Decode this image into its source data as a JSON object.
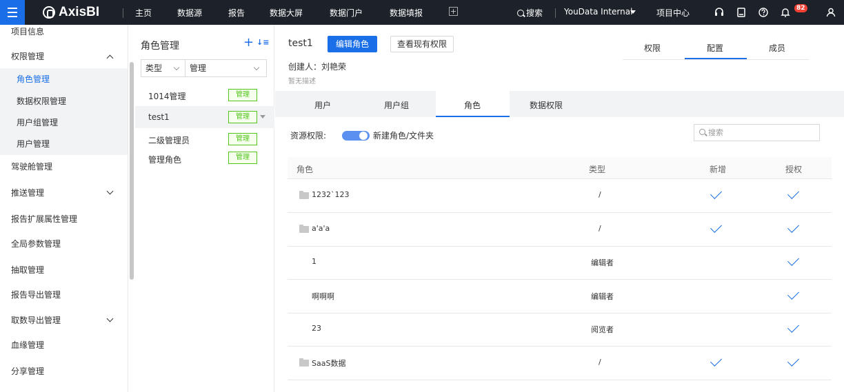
{
  "topbar": {
    "logo": "AxisBI",
    "nav": [
      "主页",
      "数据源",
      "报告",
      "数据大屏",
      "数据门户",
      "数据填报"
    ],
    "search_label": "搜索",
    "org": "YouData Internal",
    "project_center": "项目中心",
    "notification_count": "82"
  },
  "sidebar": {
    "items": [
      {
        "label": "项目信息"
      },
      {
        "label": "权限管理"
      },
      {
        "label": "角色管理"
      },
      {
        "label": "数据权限管理"
      },
      {
        "label": "用户组管理"
      },
      {
        "label": "用户管理"
      },
      {
        "label": "驾驶舱管理"
      },
      {
        "label": "推送管理"
      },
      {
        "label": "报告扩展属性管理"
      },
      {
        "label": "全局参数管理"
      },
      {
        "label": "抽取管理"
      },
      {
        "label": "报告导出管理"
      },
      {
        "label": "取数导出管理"
      },
      {
        "label": "血缘管理"
      },
      {
        "label": "分享管理"
      }
    ]
  },
  "role_panel": {
    "title": "角色管理",
    "add_icon": "plus-icon",
    "sort_icon": "sort-icon",
    "filter_type": "类型",
    "filter_value": "管理",
    "roles": [
      {
        "name": "1014管理",
        "tag": "管理"
      },
      {
        "name": "test1",
        "tag": "管理"
      },
      {
        "name": "二级管理员",
        "tag": "管理"
      },
      {
        "name": "管理角色",
        "tag": "管理"
      }
    ]
  },
  "main": {
    "role_name": "test1",
    "edit_button": "编辑角色",
    "view_button": "查看现有权限",
    "creator": "创建人：刘艳荣",
    "description": "暂无描述",
    "right_tabs": [
      "权限",
      "配置",
      "成员"
    ],
    "active_right_tab": "配置",
    "sub_tabs": [
      "用户",
      "用户组",
      "角色",
      "数据权限"
    ],
    "active_sub_tab": "角色",
    "resource_permission_label": "资源权限:",
    "new_folder_label": "新建角色/文件夹",
    "search_placeholder": "搜索",
    "table": {
      "headers": [
        "角色",
        "类型",
        "新增",
        "授权"
      ],
      "rows": [
        {
          "name": "1232`123",
          "folder": true,
          "type": "/",
          "add": true,
          "grant": true
        },
        {
          "name": "a'a'a",
          "folder": true,
          "type": "/",
          "add": true,
          "grant": true
        },
        {
          "name": "1",
          "folder": false,
          "type": "编辑者",
          "add": false,
          "grant": true
        },
        {
          "name": "啊啊啊",
          "folder": false,
          "type": "编辑者",
          "add": false,
          "grant": true
        },
        {
          "name": "23",
          "folder": false,
          "type": "阅览者",
          "add": false,
          "grant": true
        },
        {
          "name": "SaaS数据",
          "folder": true,
          "type": "/",
          "add": true,
          "grant": true
        }
      ]
    }
  },
  "colors": {
    "accent": "#1a6fe8",
    "topbar_bg": "#1d2129",
    "tag_green": "#52c41a"
  }
}
